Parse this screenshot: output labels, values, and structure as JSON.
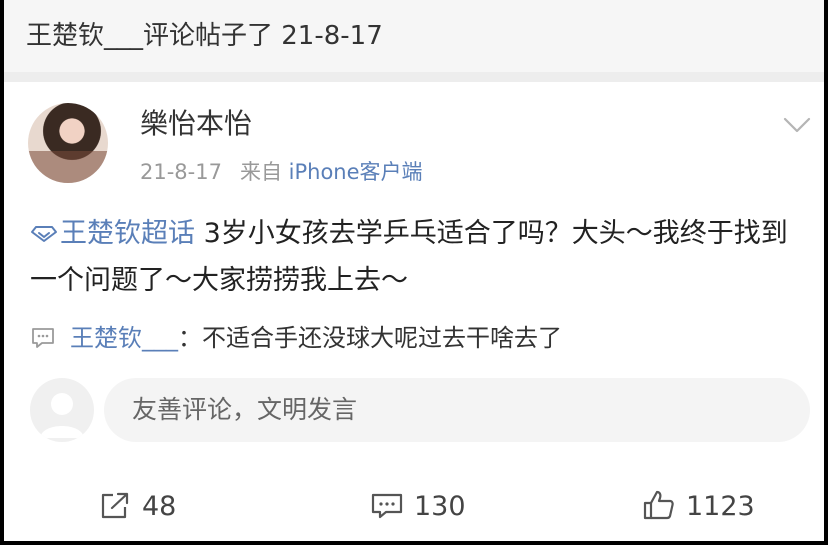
{
  "notification": "王楚钦___评论帖子了 21-8-17",
  "post": {
    "username": "樂怡本怡",
    "date": "21-8-17",
    "source_prefix": "来自",
    "source_device": "iPhone客户端",
    "topic": "王楚钦超话",
    "text": "3岁小女孩去学乒乓适合了吗？大头～我终于找到一个问题了～大家捞捞我上去～"
  },
  "comment": {
    "author": "王楚钦___",
    "separator": "：",
    "text": "不适合手还没球大呢过去干啥去了"
  },
  "compose": {
    "placeholder": "友善评论，文明发言"
  },
  "actions": {
    "share_count": "48",
    "comment_count": "130",
    "like_count": "1123"
  },
  "icons": [
    "chevron-down-icon",
    "super-topic-icon",
    "comment-bubble-icon",
    "share-icon",
    "comment-icon",
    "like-icon"
  ],
  "colors": {
    "link": "#5a7fb8",
    "text": "#222222",
    "muted": "#999999"
  }
}
